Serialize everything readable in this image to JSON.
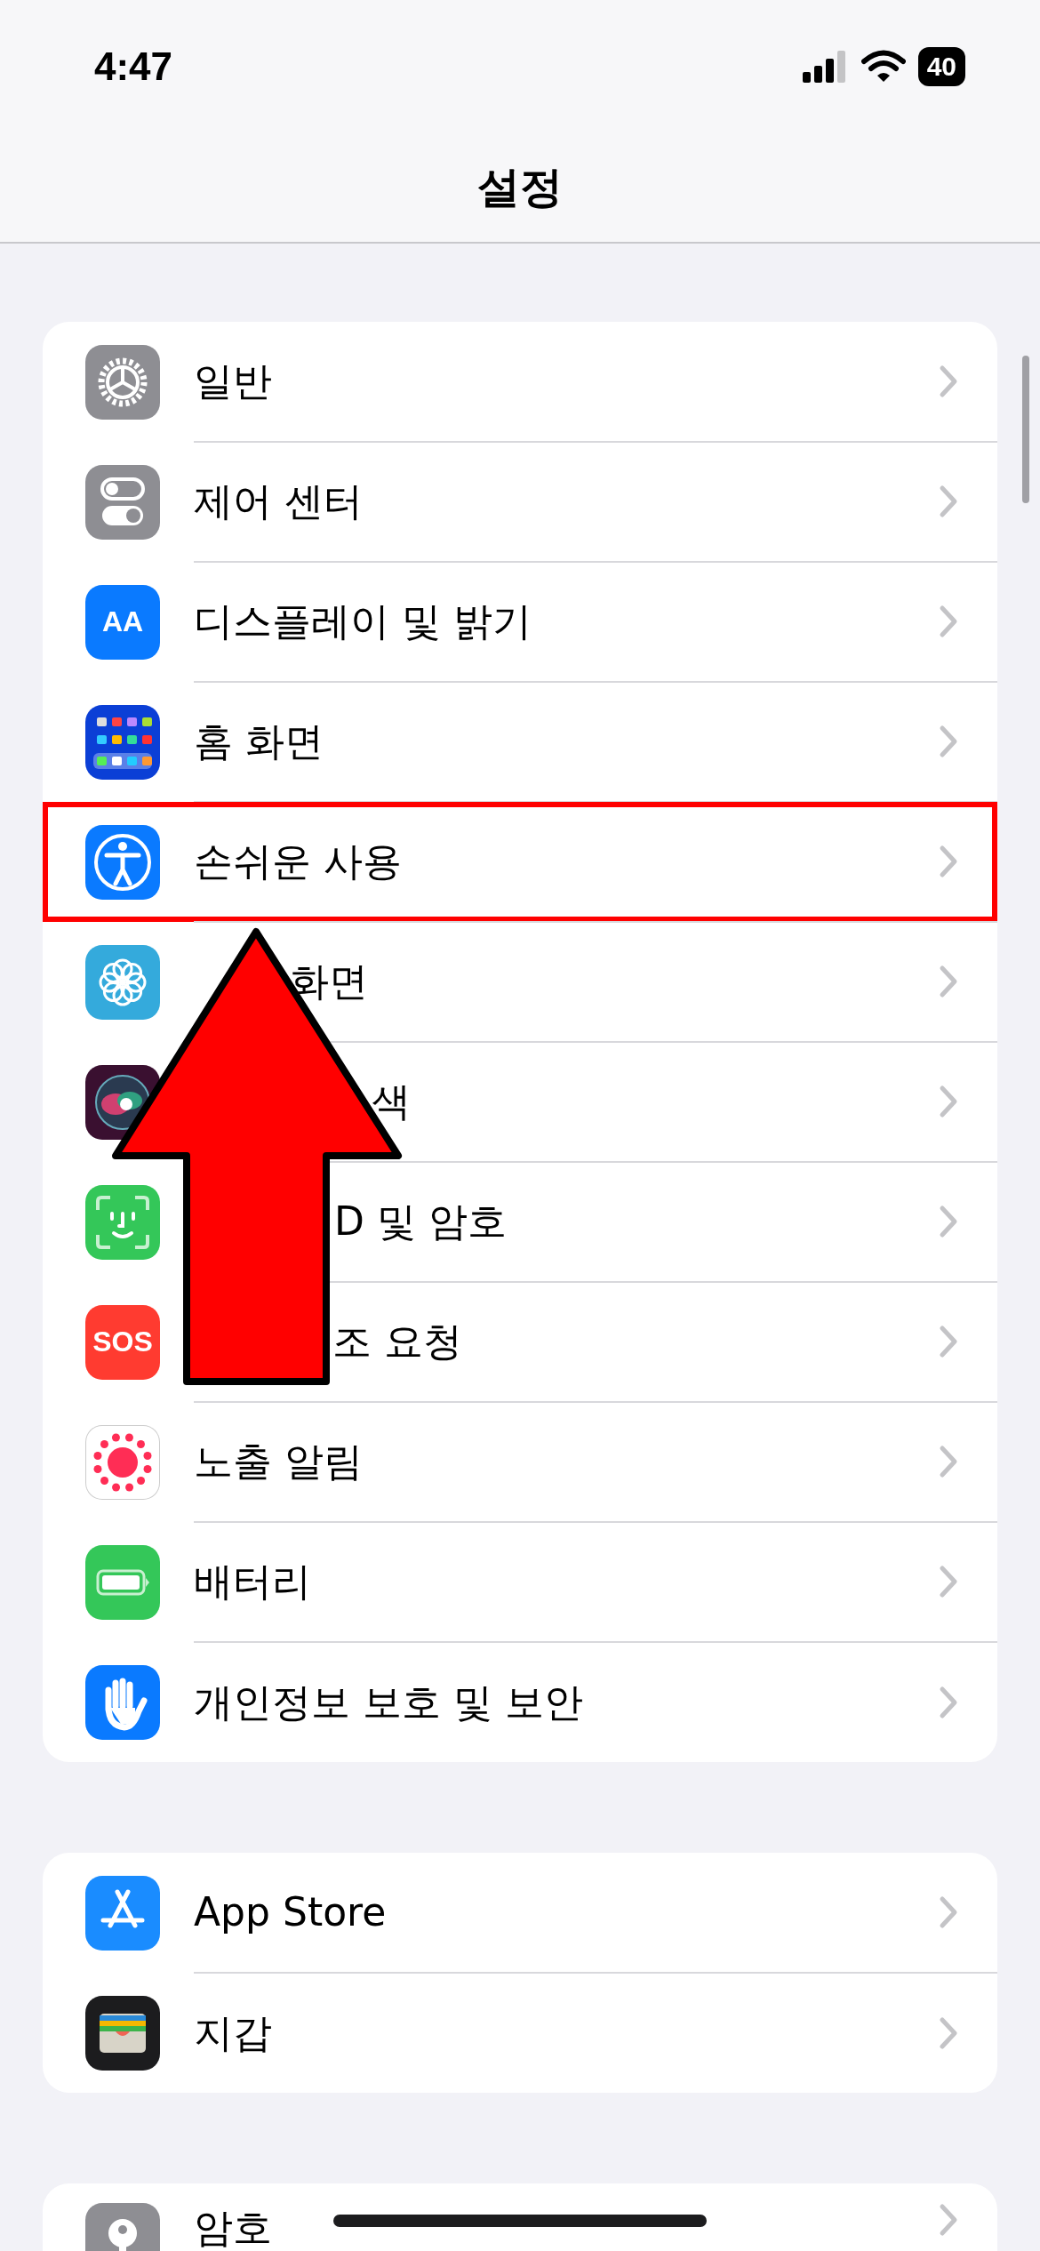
{
  "status_bar": {
    "time": "4:47",
    "battery": "40"
  },
  "nav": {
    "title": "설정"
  },
  "groups": [
    {
      "items": [
        {
          "label": "일반",
          "highlighted": false
        },
        {
          "label": "제어 센터",
          "highlighted": false
        },
        {
          "label": "디스플레이 및 밝기",
          "icon_text": "AA",
          "highlighted": false
        },
        {
          "label": "홈 화면",
          "highlighted": false
        },
        {
          "label": "손쉬운 사용",
          "highlighted": true
        },
        {
          "label": "화면",
          "highlighted": false
        },
        {
          "label": "색",
          "highlighted": false
        },
        {
          "label": "D 및 암호",
          "highlighted": false
        },
        {
          "label": "조 요청",
          "icon_text": "SOS",
          "highlighted": false
        },
        {
          "label": "노출 알림",
          "highlighted": false
        },
        {
          "label": "배터리",
          "highlighted": false
        },
        {
          "label": "개인정보 보호 및 보안",
          "highlighted": false
        }
      ]
    },
    {
      "items": [
        {
          "label": "App Store"
        },
        {
          "label": "지갑"
        }
      ]
    },
    {
      "items": [
        {
          "label": "암호"
        }
      ]
    }
  ]
}
